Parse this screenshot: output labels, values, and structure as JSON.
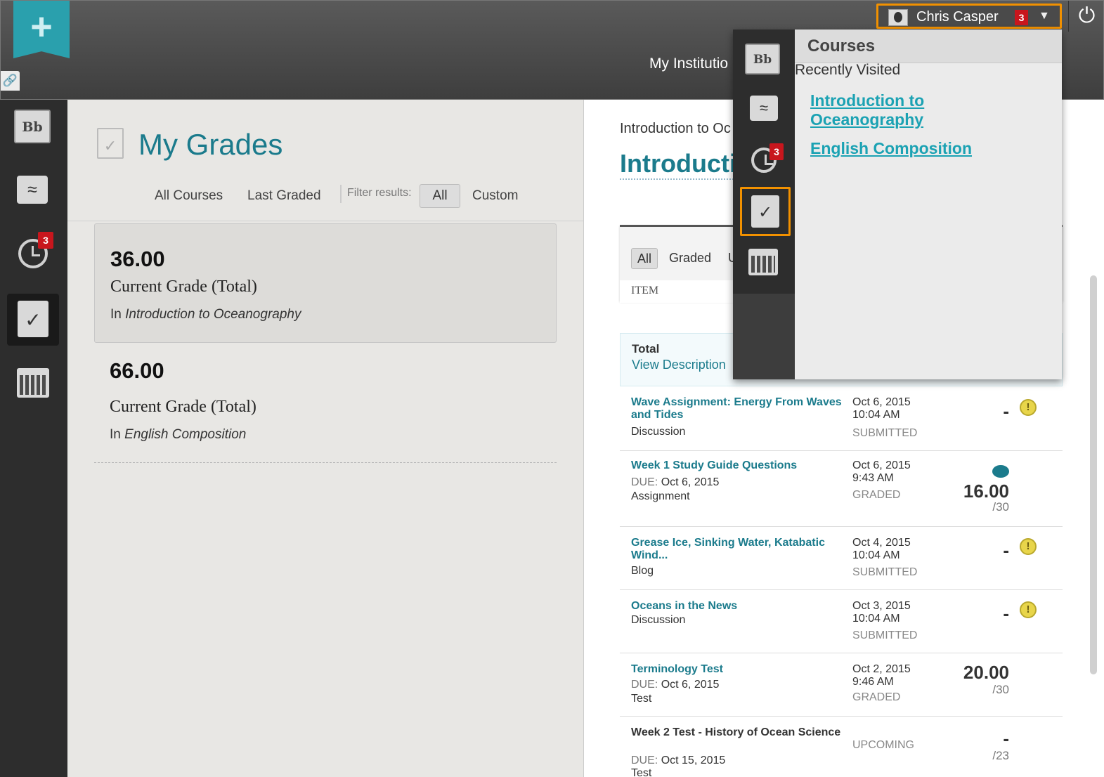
{
  "topbar": {
    "add_icon": "plus-icon",
    "link_icon": "link-icon",
    "institution_title": "My Institutio",
    "user_name": "Chris Casper",
    "notification_count": "3",
    "power_icon": "power-icon"
  },
  "rail": {
    "items": [
      {
        "name": "home",
        "icon": "bb-home-icon",
        "label": "Bb"
      },
      {
        "name": "streams",
        "icon": "waves-icon",
        "label": "≈"
      },
      {
        "name": "due-dates",
        "icon": "alarm-clock-icon",
        "badge": "3"
      },
      {
        "name": "grades",
        "icon": "grades-icon",
        "label": "✓"
      },
      {
        "name": "calendar",
        "icon": "calendar-icon"
      }
    ]
  },
  "grades": {
    "title": "My Grades",
    "filters": {
      "all_courses": "All Courses",
      "last_graded": "Last Graded",
      "filter_label": "Filter results:",
      "all": "All",
      "custom": "Custom"
    },
    "cards": [
      {
        "score": "36.00",
        "label": "Current Grade (Total)",
        "prefix": "In",
        "course": "Introduction to Oceanography"
      },
      {
        "score": "66.00",
        "label": "Current Grade (Total)",
        "prefix": "In",
        "course": "English Composition"
      }
    ]
  },
  "course": {
    "breadcrumb": "Introduction to Oc",
    "title": "Introducti",
    "filter_all": "All",
    "filter_graded": "Graded",
    "filter_u": "U",
    "item_header": "ITEM",
    "total_label": "Total",
    "total_link": "View Description",
    "rows": [
      {
        "title": "Wave Assignment: Energy From Waves and Tides",
        "type": "Discussion",
        "date": "Oct 6, 2015",
        "time": "10:04 AM",
        "status": "SUBMITTED",
        "grade": "-"
      },
      {
        "title": "Week 1 Study Guide Questions",
        "due_label": "DUE:",
        "due": "Oct 6, 2015",
        "type": "Assignment",
        "date": "Oct 6, 2015",
        "time": "9:43 AM",
        "status": "GRADED",
        "grade": "16.00",
        "out_of": "/30"
      },
      {
        "title": "Grease Ice, Sinking Water, Katabatic Wind...",
        "type": "Blog",
        "date": "Oct 4, 2015",
        "time": "10:04 AM",
        "status": "SUBMITTED",
        "grade": "-"
      },
      {
        "title": "Oceans in the News",
        "type": "Discussion",
        "date": "Oct 3, 2015",
        "time": "10:04 AM",
        "status": "SUBMITTED",
        "grade": "-"
      },
      {
        "title": "Terminology Test",
        "due_label": "DUE:",
        "due": "Oct 6, 2015",
        "type": "Test",
        "date": "Oct 2, 2015",
        "time": "9:46 AM",
        "status": "GRADED",
        "grade": "20.00",
        "out_of": "/30"
      },
      {
        "title": "Week 2 Test - History of Ocean Science",
        "due_label": "DUE:",
        "due": "Oct 15, 2015",
        "type": "Test",
        "status": "UPCOMING",
        "grade": "-",
        "out_of": "/23"
      }
    ],
    "warning_glyph": "!"
  },
  "dropdown": {
    "heading": "Courses",
    "subheading": "Recently Visited",
    "links": [
      "Introduction to Oceanography",
      "English Composition"
    ],
    "badge": "3"
  },
  "colors": {
    "accent": "#1b7b8c",
    "highlight": "#f29100",
    "badge": "#c8161d",
    "link": "#1ba2b3"
  }
}
